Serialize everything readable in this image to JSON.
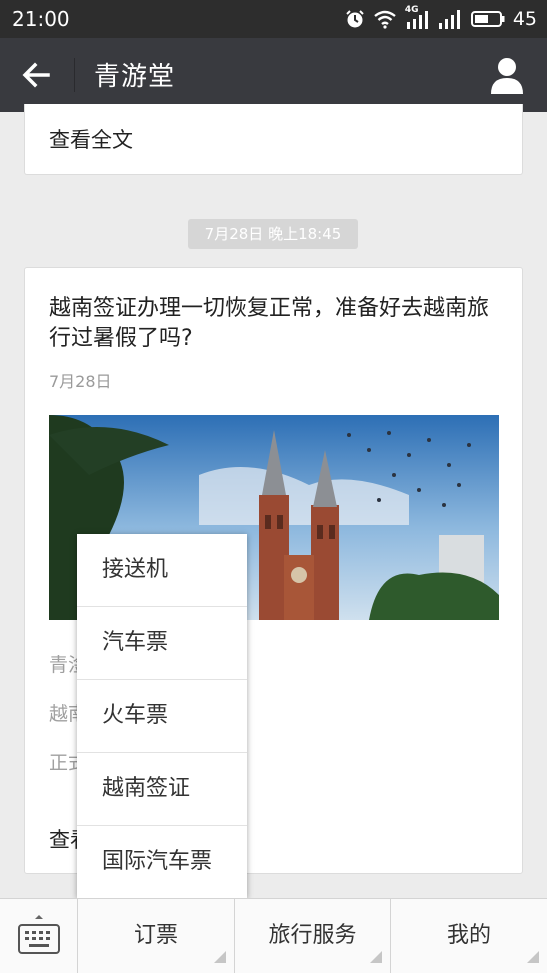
{
  "status_bar": {
    "time": "21:00",
    "battery": "45",
    "network": "4G"
  },
  "header": {
    "title": "青游堂"
  },
  "prev_card": {
    "read_more": "查看全文"
  },
  "timestamp": "7月28日 晚上18:45",
  "article": {
    "title": "越南签证办理一切恢复正常，准备好去越南旅行过暑假了吗?",
    "date": "7月28日",
    "digest_lines": [
      "青淦",
      "越南",
      "正式"
    ],
    "read_more": "查看"
  },
  "popup_menu": {
    "items": [
      "接送机",
      "汽车票",
      "火车票",
      "越南签证",
      "国际汽车票"
    ]
  },
  "bottom_menu": {
    "items": [
      "订票",
      "旅行服务",
      "我的"
    ]
  },
  "colors": {
    "status_bar": "#2d2d2d",
    "title_bar": "#393a3f",
    "background": "#ececec"
  }
}
